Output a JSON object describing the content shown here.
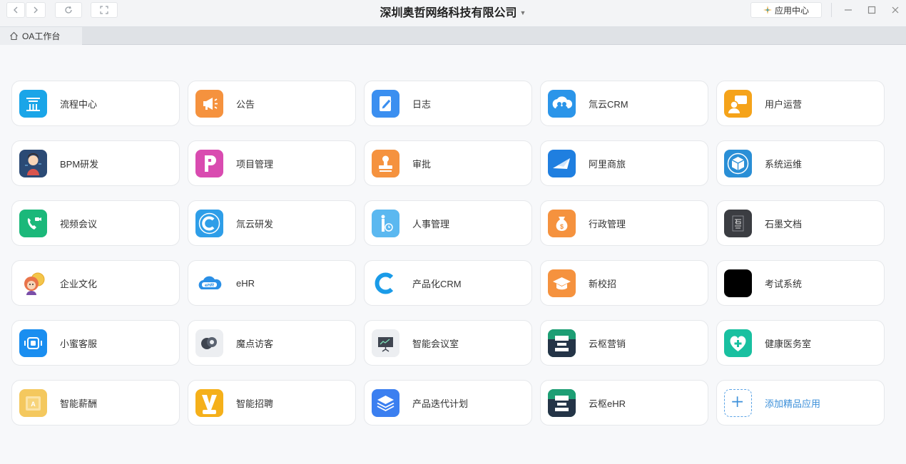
{
  "window": {
    "company": "深圳奥哲网络科技有限公司",
    "app_center_label": "应用中心"
  },
  "tabs": [
    {
      "label": "OA工作台"
    }
  ],
  "apps": [
    {
      "label": "流程中心",
      "icon": "flow-icon",
      "color": "#1aa5e8"
    },
    {
      "label": "公告",
      "icon": "megaphone-icon",
      "color": "#f5923e"
    },
    {
      "label": "日志",
      "icon": "journal-icon",
      "color": "#3b8ff0"
    },
    {
      "label": "氚云CRM",
      "icon": "cloud-people-icon",
      "color": "#2b95e9"
    },
    {
      "label": "用户运营",
      "icon": "user-chat-icon",
      "color": "#f5a31a"
    },
    {
      "label": "BPM研发",
      "icon": "avatar-girl-icon",
      "color": "#2b4a75"
    },
    {
      "label": "项目管理",
      "icon": "letter-p-icon",
      "color": "#d94bb0"
    },
    {
      "label": "审批",
      "icon": "stamp-icon",
      "color": "#f5923e"
    },
    {
      "label": "阿里商旅",
      "icon": "plane-ticket-icon",
      "color": "#1f7fe0"
    },
    {
      "label": "系统运维",
      "icon": "cube-icon",
      "color": "#2a8fd6"
    },
    {
      "label": "视频会议",
      "icon": "video-call-icon",
      "color": "#1bb87a"
    },
    {
      "label": "氚云研发",
      "icon": "ring-c-icon",
      "color": "#2e9ee8"
    },
    {
      "label": "人事管理",
      "icon": "person-clock-icon",
      "color": "#5bb8f0"
    },
    {
      "label": "行政管理",
      "icon": "money-bag-icon",
      "color": "#f5923e"
    },
    {
      "label": "石墨文档",
      "icon": "shimo-icon",
      "color": "#3b3d42"
    },
    {
      "label": "企业文化",
      "icon": "cartoon-icon",
      "color": "#f3c54a"
    },
    {
      "label": "eHR",
      "icon": "ehr-cloud-icon",
      "color": "#2a8fe6"
    },
    {
      "label": "产品化CRM",
      "icon": "c-logo-icon",
      "color": "#1a9be8"
    },
    {
      "label": "新校招",
      "icon": "grad-cap-icon",
      "color": "#f5923e"
    },
    {
      "label": "考试系统",
      "icon": "blank-icon",
      "color": "#000000"
    },
    {
      "label": "小蜜客服",
      "icon": "service-bot-icon",
      "color": "#1a8ef0"
    },
    {
      "label": "魔点访客",
      "icon": "visitor-icon",
      "color": "#eceef1"
    },
    {
      "label": "智能会议室",
      "icon": "presentation-icon",
      "color": "#eceef1"
    },
    {
      "label": "云枢营销",
      "icon": "yunshu-icon",
      "color": "#1d9e74"
    },
    {
      "label": "健康医务室",
      "icon": "heart-plus-icon",
      "color": "#19c0a0"
    },
    {
      "label": "智能薪酬",
      "icon": "salary-card-icon",
      "color": "#f4c85e"
    },
    {
      "label": "智能招聘",
      "icon": "recruit-v-icon",
      "color": "#f5b01a"
    },
    {
      "label": "产品迭代计划",
      "icon": "layers-icon",
      "color": "#3b7ff0"
    },
    {
      "label": "云枢eHR",
      "icon": "yunshu-icon",
      "color": "#1d9e74"
    },
    {
      "label": "添加精品应用",
      "icon": "plus-icon",
      "color": "#5aa3e6"
    }
  ]
}
